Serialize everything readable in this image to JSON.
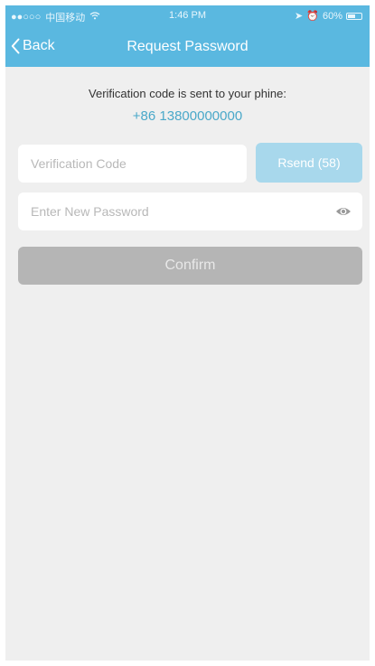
{
  "status_bar": {
    "carrier": "中国移动",
    "time": "1:46 PM",
    "battery": "60%"
  },
  "nav": {
    "back_label": "Back",
    "title": "Request Password"
  },
  "verification": {
    "message": "Verification code is sent to your phine:",
    "phone": "+86 13800000000"
  },
  "form": {
    "code_placeholder": "Verification Code",
    "resend_label": "Rsend (58)",
    "password_placeholder": "Enter New Password",
    "confirm_label": "Confirm"
  },
  "icons": {
    "back": "chevron-left-icon",
    "show_password": "eye-icon",
    "wifi": "wifi-icon",
    "battery": "battery-icon"
  },
  "colors": {
    "header": "#5ab8e0",
    "accent_text": "#4aa8c9",
    "resend_button": "#a8d8ec",
    "confirm_button": "#b5b5b5",
    "background": "#efefef"
  }
}
